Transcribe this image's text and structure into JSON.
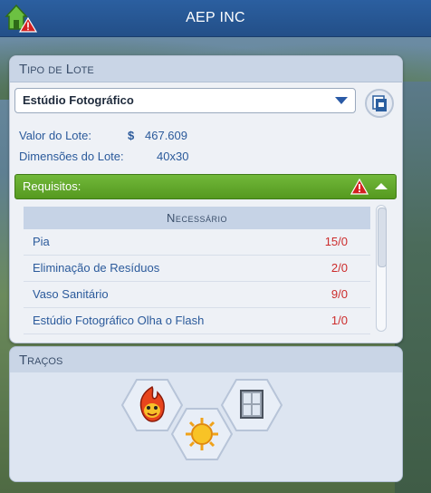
{
  "window": {
    "title": "AEP INC"
  },
  "lot_panel": {
    "header": "Tipo de Lote",
    "lot_type_selected": "Estúdio Fotográfico",
    "lot_value_label": "Valor do Lote:",
    "lot_value_currency": "$",
    "lot_value": "467.609",
    "lot_size_label": "Dimensões do Lote:",
    "lot_size": "40x30"
  },
  "requirements": {
    "label": "Requisitos:",
    "table_header": "Necessário",
    "rows": [
      {
        "name": "Pia",
        "value": "15/0"
      },
      {
        "name": "Eliminação de Resíduos",
        "value": "2/0"
      },
      {
        "name": "Vaso Sanitário",
        "value": "9/0"
      },
      {
        "name": "Estúdio Fotográfico Olha o Flash",
        "value": "1/0"
      }
    ]
  },
  "traits": {
    "header": "Traços"
  },
  "icons": {
    "home": "house-icon",
    "warning": "warning-icon",
    "lot_info": "lot-info-icon",
    "trait_1": "fire-monster-trait-icon",
    "trait_2": "sun-trait-icon",
    "trait_3": "window-trait-icon"
  },
  "colors": {
    "accent_blue": "#2b5fa0",
    "requirements_green": "#5fa82a",
    "value_red": "#cc2b2b"
  }
}
